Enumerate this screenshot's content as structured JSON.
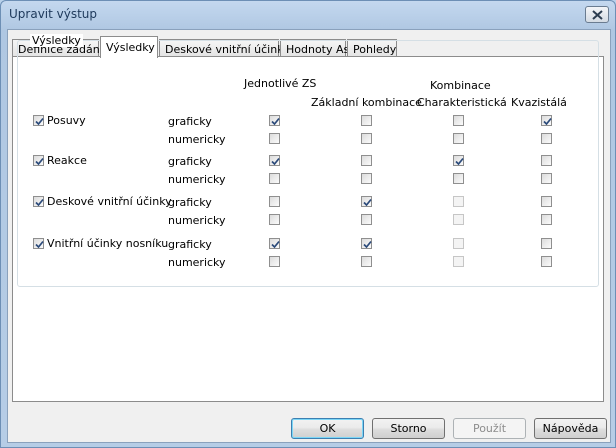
{
  "window": {
    "title": "Upravit výstup"
  },
  "tabs": [
    {
      "label": "Definice zadání",
      "active": false
    },
    {
      "label": "Výsledky",
      "active": true
    },
    {
      "label": "Deskové vnitřní účinky",
      "active": false
    },
    {
      "label": "Hodnoty As",
      "active": false
    },
    {
      "label": "Pohledy",
      "active": false
    }
  ],
  "group": {
    "title": "Výsledky",
    "header_jednotlive": "Jednotlivé ZS",
    "header_kombinace": "Kombinace",
    "columns": [
      "Základní kombinace",
      "Charakteristická",
      "Kvazistálá"
    ]
  },
  "modes": {
    "graphic": "graficky",
    "numeric": "numericky"
  },
  "rows": [
    {
      "label": "Posuvy",
      "checked": true,
      "graficky": [
        true,
        false,
        false,
        true
      ],
      "numericky": [
        false,
        false,
        false,
        false
      ],
      "disabled_graficky": [
        false,
        false,
        false,
        false
      ],
      "disabled_numericky": [
        false,
        false,
        false,
        false
      ]
    },
    {
      "label": "Reakce",
      "checked": true,
      "graficky": [
        true,
        false,
        true,
        false
      ],
      "numericky": [
        false,
        false,
        false,
        false
      ],
      "disabled_graficky": [
        false,
        false,
        false,
        false
      ],
      "disabled_numericky": [
        false,
        false,
        false,
        false
      ]
    },
    {
      "label": "Deskové vnitřní účinky",
      "checked": true,
      "graficky": [
        false,
        true,
        false,
        false
      ],
      "numericky": [
        false,
        false,
        false,
        false
      ],
      "disabled_graficky": [
        false,
        false,
        true,
        false
      ],
      "disabled_numericky": [
        false,
        false,
        true,
        false
      ]
    },
    {
      "label": "Vnitřní účinky nosníku",
      "checked": true,
      "graficky": [
        true,
        true,
        false,
        false
      ],
      "numericky": [
        false,
        false,
        false,
        false
      ],
      "disabled_graficky": [
        false,
        false,
        true,
        false
      ],
      "disabled_numericky": [
        false,
        false,
        true,
        false
      ]
    }
  ],
  "buttons": {
    "ok": "OK",
    "cancel": "Storno",
    "apply": "Použít",
    "help": "Nápověda"
  }
}
